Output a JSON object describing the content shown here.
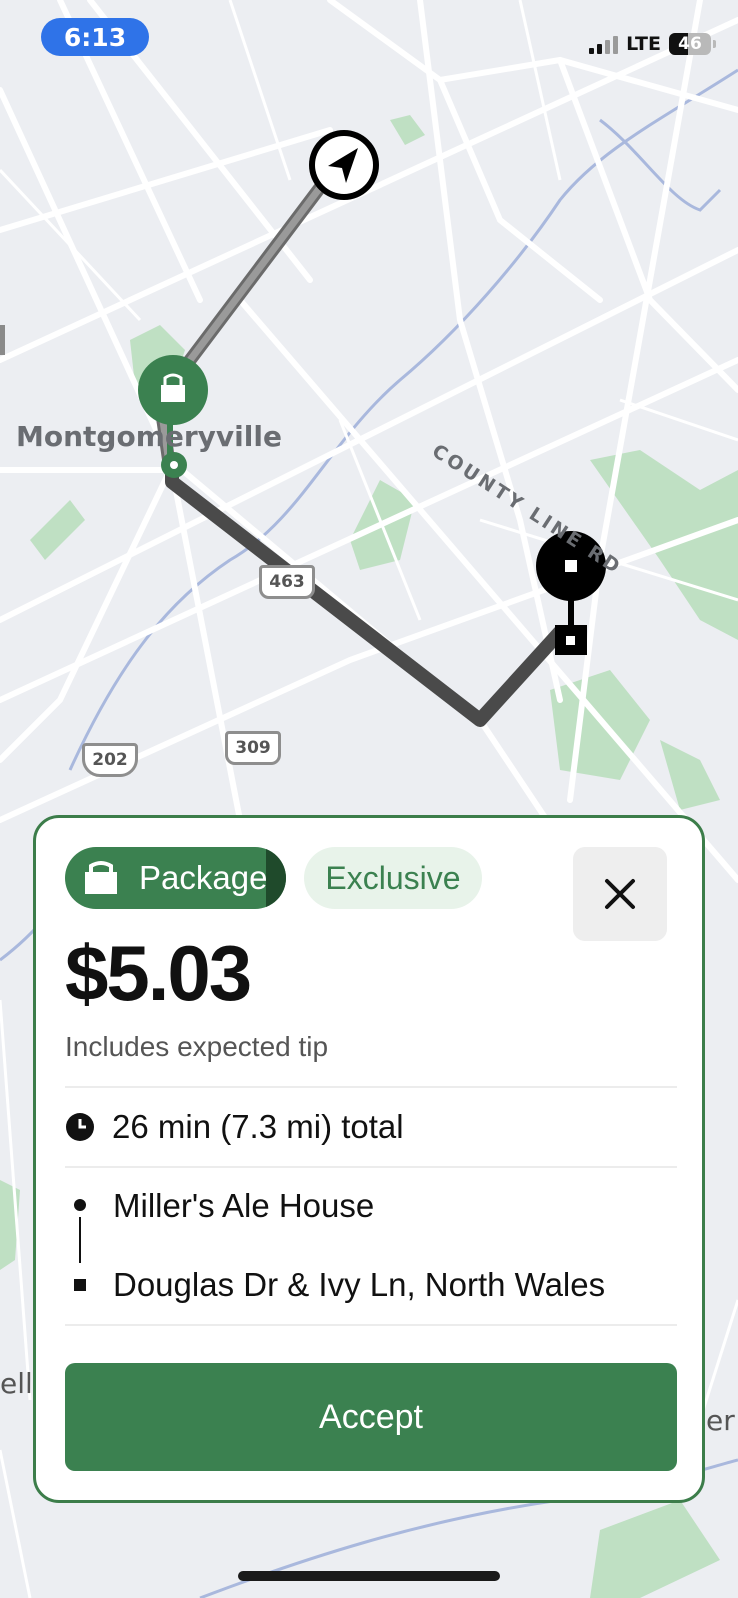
{
  "status_bar": {
    "time": "6:13",
    "network": "LTE",
    "battery": "46"
  },
  "map": {
    "town_label": "Montgomeryville",
    "road_label": "COUNTY LINE RD",
    "route_shields": [
      "463",
      "309",
      "202"
    ],
    "edge_labels": [
      "ell",
      "er"
    ]
  },
  "offer": {
    "type_label": "Package",
    "tag_label": "Exclusive",
    "price": "$5.03",
    "price_note": "Includes expected tip",
    "duration": "26 min (7.3 mi) total",
    "pickup": "Miller's Ale House",
    "dropoff": "Douglas Dr & Ivy Ln, North Wales",
    "accept_label": "Accept",
    "close_label": "×"
  },
  "colors": {
    "accent": "#3b8150",
    "accent_light": "#e8f3ea",
    "route": "#4a4a4a",
    "status_pill": "#2f73e8"
  }
}
